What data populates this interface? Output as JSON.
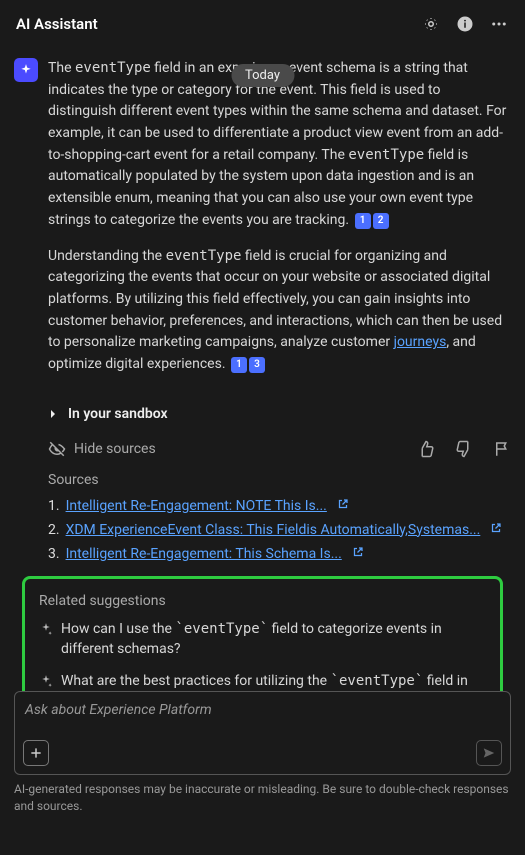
{
  "header": {
    "title": "AI Assistant"
  },
  "dateChip": "Today",
  "message": {
    "p1_part1": "The ",
    "p1_code1": "eventType",
    "p1_part2": " field in an experience event schema is a string that indicates the type or category for the event. This field is used to distinguish different event types within the same schema and dataset. For example, it can be used to differentiate a product view event from an add-to-shopping-cart event for a retail company. The ",
    "p1_code2": "eventType",
    "p1_part3": " field is automatically populated by the system upon data ingestion and is an extensible enum, meaning that you can also use your own event type strings to categorize the events you are tracking. ",
    "p1_refs": [
      "1",
      "2"
    ],
    "p2_part1": "Understanding the ",
    "p2_code1": "eventType",
    "p2_part2": " field is crucial for organizing and categorizing the events that occur on your website or associated digital platforms. By utilizing this field effectively, you can gain insights into customer behavior, preferences, and interactions, which can then be used to personalize marketing campaigns, analyze customer ",
    "p2_link": "journeys",
    "p2_part3": ", and optimize digital experiences. ",
    "p2_refs": [
      "1",
      "3"
    ]
  },
  "expander": {
    "label": "In your sandbox"
  },
  "hideSources": "Hide sources",
  "sources": {
    "title": "Sources",
    "items": [
      {
        "num": "1.",
        "label": "Intelligent Re-Engagement: NOTE This Is... "
      },
      {
        "num": "2.",
        "label": "XDM ExperienceEvent Class: This Fieldis Automatically,Systemas... "
      },
      {
        "num": "3.",
        "label": "Intelligent Re-Engagement: This Schema Is... "
      }
    ]
  },
  "related": {
    "title": "Related suggestions",
    "items": [
      {
        "pre": "How can I use the ",
        "code": "`eventType`",
        "post": " field to categorize events in different schemas?"
      },
      {
        "pre": "What are the best practices for utilizing the ",
        "code": "`eventType`",
        "post": " field in an experience event schema?"
      }
    ]
  },
  "input": {
    "placeholder": "Ask about Experience Platform"
  },
  "disclaimer": "AI-generated responses may be inaccurate or misleading. Be sure to double-check responses and sources."
}
